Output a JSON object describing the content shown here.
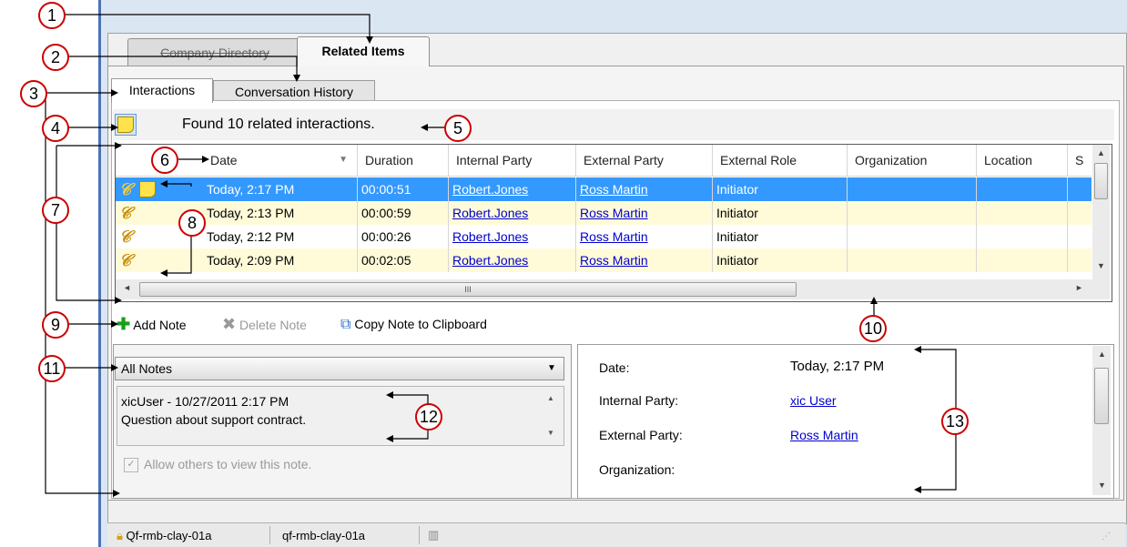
{
  "outer_tabs": [
    "Company Directory",
    "Related Items"
  ],
  "inner_tabs": [
    "Interactions",
    "Conversation History"
  ],
  "found_text": "Found 10 related interactions.",
  "columns": [
    "Date",
    "Duration",
    "Internal Party",
    "External Party",
    "External Role",
    "Organization",
    "Location",
    "S"
  ],
  "rows": [
    {
      "date": "Today, 2:17 PM",
      "duration": "00:00:51",
      "internal": "Robert.Jones",
      "external": "Ross Martin",
      "role": "Initiator"
    },
    {
      "date": "Today, 2:13 PM",
      "duration": "00:00:59",
      "internal": "Robert.Jones",
      "external": "Ross Martin",
      "role": "Initiator"
    },
    {
      "date": "Today, 2:12 PM",
      "duration": "00:00:26",
      "internal": "Robert.Jones",
      "external": "Ross Martin",
      "role": "Initiator"
    },
    {
      "date": "Today, 2:09 PM",
      "duration": "00:02:05",
      "internal": "Robert.Jones",
      "external": "Ross Martin",
      "role": "Initiator"
    }
  ],
  "scroll_mid": "III",
  "toolbar": {
    "add": "Add Note",
    "delete": "Delete Note",
    "copy": "Copy Note to Clipboard"
  },
  "notes_filter": "All Notes",
  "note_header": "xicUser - 10/27/2011 2:17 PM",
  "note_text": "Question about support contract.",
  "allow_label": "Allow others to view this note.",
  "details": [
    {
      "label": "Date:",
      "value": "Today, 2:17 PM",
      "link": false
    },
    {
      "label": "Internal Party:",
      "value": "xic User",
      "link": true
    },
    {
      "label": "External Party:",
      "value": "Ross Martin",
      "link": true
    },
    {
      "label": "Organization:",
      "value": "",
      "link": false
    }
  ],
  "status": {
    "item1": "Qf-rmb-clay-01a",
    "item2": "qf-rmb-clay-01a"
  },
  "callouts": [
    "1",
    "2",
    "3",
    "4",
    "5",
    "6",
    "7",
    "8",
    "9",
    "10",
    "11",
    "12",
    "13"
  ],
  "colors": {
    "selection": "#3399ff",
    "alt_row": "#fffbd9",
    "callout_border": "#cc0000",
    "link": "#0000cc"
  }
}
